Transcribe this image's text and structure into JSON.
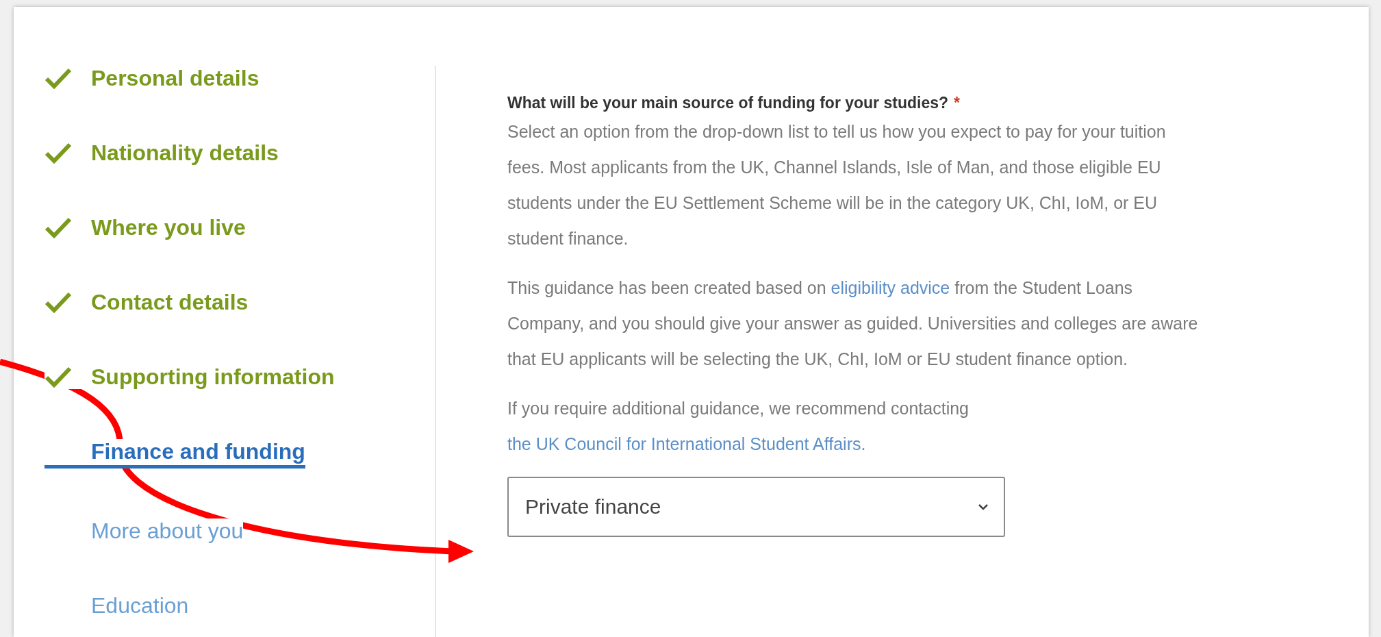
{
  "sidebar": {
    "items": [
      {
        "label": "Personal details",
        "kind": "complete"
      },
      {
        "label": "Nationality details",
        "kind": "complete"
      },
      {
        "label": "Where you live",
        "kind": "complete"
      },
      {
        "label": "Contact details",
        "kind": "complete"
      },
      {
        "label": "Supporting information",
        "kind": "complete"
      },
      {
        "label": "Finance and funding",
        "kind": "current"
      },
      {
        "label": "More about you",
        "kind": "pending"
      },
      {
        "label": "Education",
        "kind": "pending"
      }
    ]
  },
  "question": {
    "label": "What will be your main source of funding for your studies?",
    "required_mark": "*",
    "paragraphs": [
      [
        {
          "text": "Select an option from the drop-down list to tell us how you expect to pay for your tuition fees. Most applicants from the UK, Channel Islands, Isle of Man, and those eligible EU students under the EU Settlement Scheme will be in the category UK, ChI, IoM, or EU student finance."
        }
      ],
      [
        {
          "text": "This guidance has been created based on "
        },
        {
          "text": "eligibility advice",
          "link": true
        },
        {
          "text": " from the Student Loans Company, and you should give your answer as guided. Universities and colleges are aware that EU applicants will be selecting the UK, ChI, IoM or EU student finance option."
        }
      ],
      [
        {
          "text": "If you require additional guidance, we recommend contacting "
        },
        {
          "text": "the UK Council for International Student Affairs.",
          "link": true
        }
      ]
    ],
    "select": {
      "value": "Private finance"
    }
  }
}
